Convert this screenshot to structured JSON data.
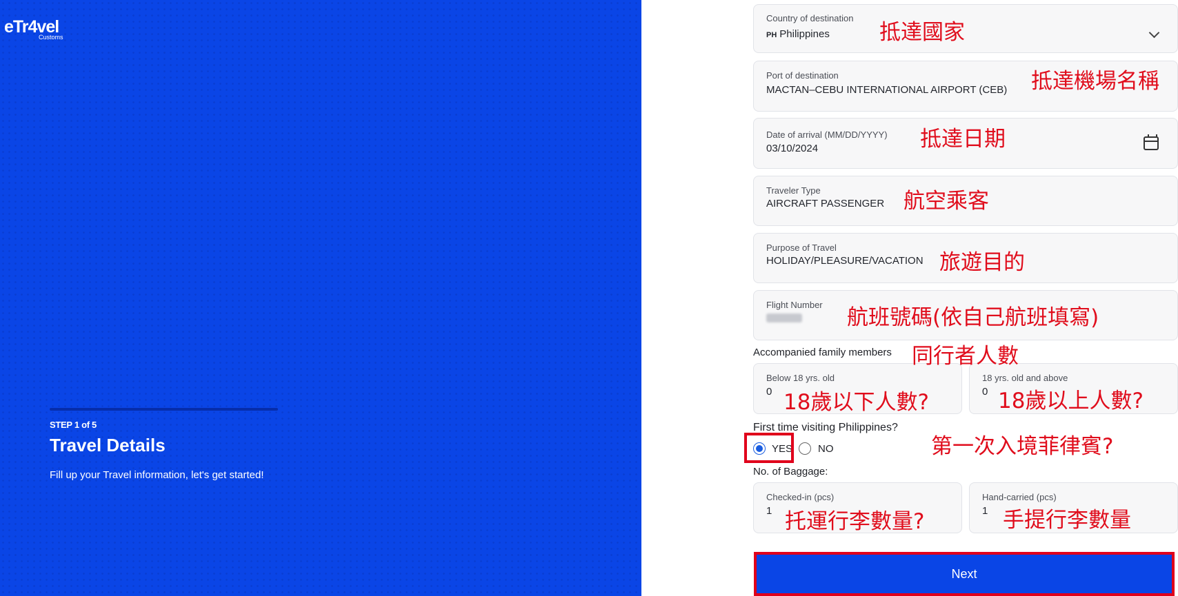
{
  "brand": {
    "logo_text": "eTr4vel",
    "logo_sub": "Customs"
  },
  "left_panel": {
    "step": "STEP 1 of 5",
    "title": "Travel Details",
    "subtitle": "Fill up your Travel information, let's get started!"
  },
  "form": {
    "country": {
      "label": "Country of destination",
      "flag_code": "PH",
      "value": "Philippines"
    },
    "port": {
      "label": "Port of destination",
      "value": "MACTAN–CEBU INTERNATIONAL AIRPORT (CEB)"
    },
    "arrival": {
      "label": "Date of arrival (MM/DD/YYYY)",
      "value": "03/10/2024"
    },
    "traveler_type": {
      "label": "Traveler Type",
      "value": "AIRCRAFT PASSENGER"
    },
    "purpose": {
      "label": "Purpose of Travel",
      "value": "HOLIDAY/PLEASURE/VACATION"
    },
    "flight": {
      "label": "Flight Number",
      "value": ""
    },
    "family": {
      "label": "Accompanied family members",
      "below18": {
        "label": "Below 18 yrs. old",
        "value": "0"
      },
      "above18": {
        "label": "18 yrs. old and above",
        "value": "0"
      }
    },
    "first_time": {
      "label": "First time visiting Philippines?",
      "yes": "YES",
      "no": "NO",
      "selected": "YES"
    },
    "baggage": {
      "label": "No. of Baggage:",
      "checked": {
        "label": "Checked-in (pcs)",
        "value": "1"
      },
      "hand": {
        "label": "Hand-carried (pcs)",
        "value": "1"
      }
    },
    "next_label": "Next"
  },
  "annotations": {
    "country": "抵達國家",
    "port": "抵達機場名稱",
    "date": "抵達日期",
    "traveler": "航空乘客",
    "purpose": "旅遊目的",
    "flight": "航班號碼(依自己航班填寫)",
    "family": "同行者人數",
    "below18": "18歲以下人數?",
    "above18": "18歲以上人數?",
    "first_time": "第一次入境菲律賓?",
    "checked": "托運行李數量?",
    "hand": "手提行李數量"
  },
  "colors": {
    "brand_blue": "#0a45e6",
    "annotation_red": "#e00d1c"
  }
}
